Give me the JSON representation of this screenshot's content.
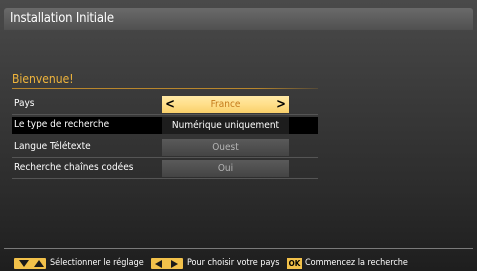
{
  "window": {
    "title": "Installation Initiale"
  },
  "section": {
    "heading": "Bienvenue!"
  },
  "settings": [
    {
      "label": "Pays",
      "value": "France"
    },
    {
      "label": "Le type de recherche",
      "value": "Numérique uniquement"
    },
    {
      "label": "Langue Télétexte",
      "value": "Ouest"
    },
    {
      "label": "Recherche chaînes codées",
      "value": "Oui"
    }
  ],
  "footer": {
    "updown_hint": "Sélectionner le réglage",
    "leftright_hint": "Pour choisir votre pays",
    "ok_key": "OK",
    "ok_hint": "Commencez la recherche"
  },
  "colors": {
    "accent_yellow": "#f2c14a",
    "heading_orange": "#f0b53c",
    "background": "#3a3a3a"
  }
}
